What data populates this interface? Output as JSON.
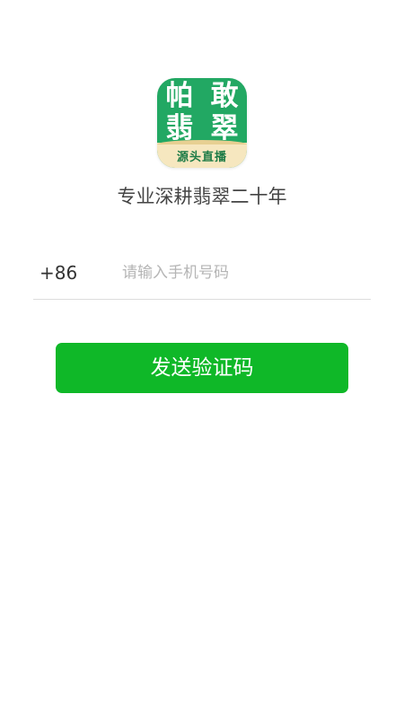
{
  "app": {
    "logo_chars": [
      "帕",
      "敢",
      "翡",
      "翠"
    ],
    "logo_tagline": "源头直播",
    "slogan": "专业深耕翡翠二十年"
  },
  "login": {
    "country_code": "+86",
    "phone_value": "",
    "phone_placeholder": "请输入手机号码",
    "send_button_label": "发送验证码"
  },
  "colors": {
    "logo_green": "#22a863",
    "logo_band": "#f6e7bf",
    "button_green": "#0fb828",
    "placeholder": "#b5b5b5",
    "divider": "#dddddd"
  }
}
